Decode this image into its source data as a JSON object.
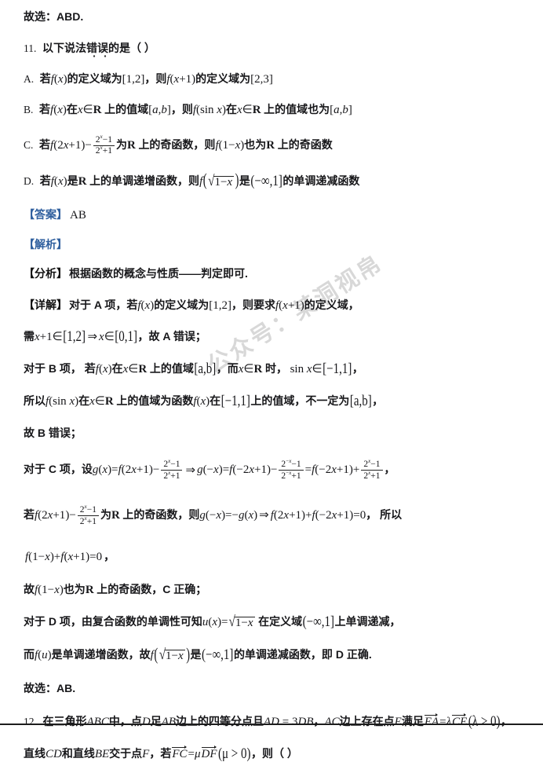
{
  "document": {
    "type": "math-exam-solution-page",
    "language": "zh-CN",
    "watermark": "公众号：某洞视帛",
    "blue_label_color": "#2f5f9e",
    "background_color": "#ffffff"
  },
  "prev_answer": {
    "text": "故选：ABD."
  },
  "question_11": {
    "number": "11.",
    "stem_prefix": "以下说法",
    "stem_emphasis": "错误",
    "stem_suffix": "的是（     ）",
    "options": {
      "a_letter": "A.",
      "a_p1": "若",
      "a_f": "f",
      "a_x": "(x)",
      "a_p2": "的定义域为",
      "a_interval1": "[1,2]",
      "a_p3": "，则",
      "a_f2": "f",
      "a_arg2": "(x+1)",
      "a_p4": "的定义域为",
      "a_interval2": "[2,3]",
      "b_letter": "B.",
      "b_p1": "若",
      "b_arg": "(x)",
      "b_p2": "在",
      "b_x": "x",
      "b_in": "∈",
      "b_R": "R",
      "b_p3": "上的值域",
      "b_ab": "[a,b]",
      "b_p4": "，则",
      "b_arg2": "(sin x)",
      "b_p5": "在",
      "b_p6": "上的值域也为",
      "b_ab2": "[a,b]",
      "c_letter": "C.",
      "c_p1": "若",
      "c_arg": "(2x+1)",
      "c_minus": "−",
      "c_num": "2ˣ−1",
      "c_den": "2ˣ+1",
      "c_p2": "为",
      "c_R": "R",
      "c_p3": "上的奇函数，则",
      "c_arg2": "(1−x)",
      "c_p4": "也为",
      "c_p5": "上的奇函数",
      "d_letter": "D.",
      "d_p1": "若",
      "d_arg": "(x)",
      "d_p2": "是",
      "d_R": "R",
      "d_p3": "上的单调递增函数，则",
      "d_sqrt": "√(1−x)",
      "d_p4": "是",
      "d_interval": "(−∞,1]",
      "d_p5": "的单调递减函数"
    },
    "answer_label": "【答案】",
    "answer_value": "AB",
    "analysis_label": "【解析】",
    "fenxi_label": "【分析】",
    "fenxi_text": "根据函数的概念与性质——判定即可.",
    "xiangjie_label": "【详解】",
    "solution": {
      "l1_a": "对于 A 项，若",
      "l1_b": "的定义域为",
      "l1_interval": "[1,2]",
      "l1_c": "，则要求",
      "l1_d": "的定义域，",
      "l2_a": "需",
      "l2_x1": "x+1∈",
      "l2_i1": "[1,2]",
      "l2_imp": "⇒",
      "l2_x2": "x∈",
      "l2_i2": "[0,1]",
      "l2_b": "，故 A 错误；",
      "l3_a": "对于 B 项，  若",
      "l3_b": "在",
      "l3_c": "上的值域",
      "l3_ab": "[a,b]",
      "l3_d": "，而",
      "l3_e": "时，",
      "l3_sin": "sin x∈",
      "l3_i": "[−1,1]",
      "l3_f": "，",
      "l4_a": "所以",
      "l4_b": "在",
      "l4_c": "上的值域为函数",
      "l4_d": "在",
      "l4_i": "[−1,1]",
      "l4_e": "上的值域，不一定为",
      "l4_ab": "[a,b]",
      "l4_f": "，",
      "l5": "故 B 错误；",
      "l6_a": "对于 C 项，设",
      "l6_g": "g",
      "l6_gx": "(x)=",
      "l6_f1": "(2x+1)",
      "l6_minus": "−",
      "l6_n1": "2ˣ−1",
      "l6_d1": "2ˣ+1",
      "l6_imp": "⇒",
      "l6_gnx": "g(−x)=",
      "l6_f2": "(−2x+1)",
      "l6_n2": "2⁻ˣ−1",
      "l6_d2": "2⁻ˣ+1",
      "l6_eq": "=",
      "l6_f3": "(−2x+1)",
      "l6_plus": "+",
      "l6_n3": "2ˣ−1",
      "l6_d3": "2ˣ+1",
      "l6_end": "，",
      "l7_a": "若",
      "l7_f": "(2x+1)",
      "l7_n": "2ˣ−1",
      "l7_d": "2ˣ+1",
      "l7_b": "为",
      "l7_R": "R",
      "l7_c": "上的奇函数，则",
      "l7_g": "g(−x)=−g(x)",
      "l7_imp": "⇒",
      "l7_f2": "(2x+1)+",
      "l7_f3": "(−2x+1)=0",
      "l7_d2": "，  所以",
      "l8_f1": "(1−x)+",
      "l8_f2": "(x+1)=0",
      "l8_end": "，",
      "l9_a": "故",
      "l9_f": "(1−x)",
      "l9_b": "也为",
      "l9_R": "R",
      "l9_c": "上的奇函数，C 正确；",
      "l10_a": "对于 D 项，由复合函数的单调性可知",
      "l10_u": "u",
      "l10_ux": "(x)=",
      "l10_sqrt": "√(1−x)",
      "l10_b": "在定义域",
      "l10_i": "(−∞,1]",
      "l10_c": "上单调递减，",
      "l11_a": "而",
      "l11_fu": "(u)",
      "l11_b": "是单调递增函数，故",
      "l11_sqrt": "√(1−x)",
      "l11_c": "是",
      "l11_i": "(−∞,1]",
      "l11_d": "的单调递减函数，即 D 正确.",
      "l12": "故选：AB."
    }
  },
  "question_12": {
    "number": "12.",
    "l1_a": "在三角形",
    "l1_abc": "ABC",
    "l1_b": "中，点",
    "l1_D": "D",
    "l1_c": "足",
    "l1_AB": "AB",
    "l1_d": "边上的四等分点且",
    "l1_eq1": "AD = 3DB",
    "l1_e": "，",
    "l1_AC": "AC",
    "l1_f": "边上存在点",
    "l1_E": "E",
    "l1_g": "满足",
    "l1_vec1": "EA",
    "l1_eq2": "=",
    "l1_lam": "λ",
    "l1_vec2": "CE",
    "l1_cond": "(λ > 0)",
    "l1_h": "，",
    "l2_a": "直线",
    "l2_CD": "CD",
    "l2_b": "和直线",
    "l2_BE": "BE",
    "l2_c": "交于点",
    "l2_F": "F",
    "l2_d": "，若",
    "l2_vec1": "FC",
    "l2_eq": "=",
    "l2_mu": "μ",
    "l2_vec2": "DF",
    "l2_cond": "(μ > 0)",
    "l2_e": "，则（     ）"
  }
}
